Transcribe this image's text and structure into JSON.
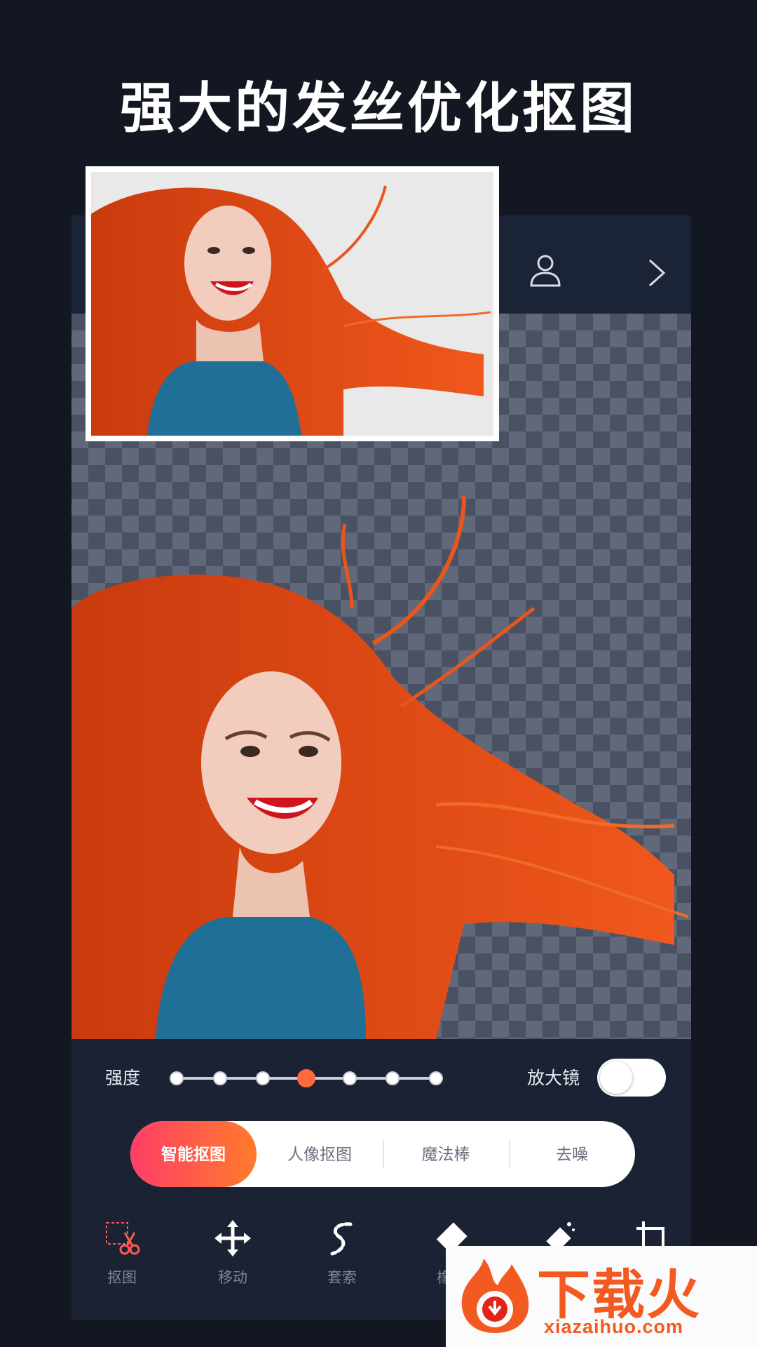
{
  "headline": "强大的发丝优化抠图",
  "topbar": {
    "icons": [
      "user-silhouette-icon",
      "chevron-right-icon"
    ]
  },
  "controls": {
    "strength_label": "强度",
    "strength_level": 4,
    "strength_levels": 7,
    "magnifier_label": "放大镜",
    "magnifier_on": false
  },
  "modes": [
    {
      "label": "智能抠图",
      "active": true
    },
    {
      "label": "人像抠图",
      "active": false
    },
    {
      "label": "魔法棒",
      "active": false
    },
    {
      "label": "去噪",
      "active": false
    }
  ],
  "tools": [
    {
      "label": "抠图",
      "icon": "scissors-icon"
    },
    {
      "label": "移动",
      "icon": "move-arrows-icon"
    },
    {
      "label": "套索",
      "icon": "lasso-icon"
    },
    {
      "label": "橡皮",
      "icon": "eraser-icon"
    },
    {
      "label": "",
      "icon": "magic-eraser-icon"
    },
    {
      "label": "",
      "icon": "crop-icon"
    }
  ],
  "watermark": {
    "title": "下载火",
    "url": "xiazaihuo.com"
  },
  "colors": {
    "accent_start": "#ff3e67",
    "accent_end": "#ff7b2b",
    "bg": "#121722",
    "panel": "#1b2233"
  }
}
